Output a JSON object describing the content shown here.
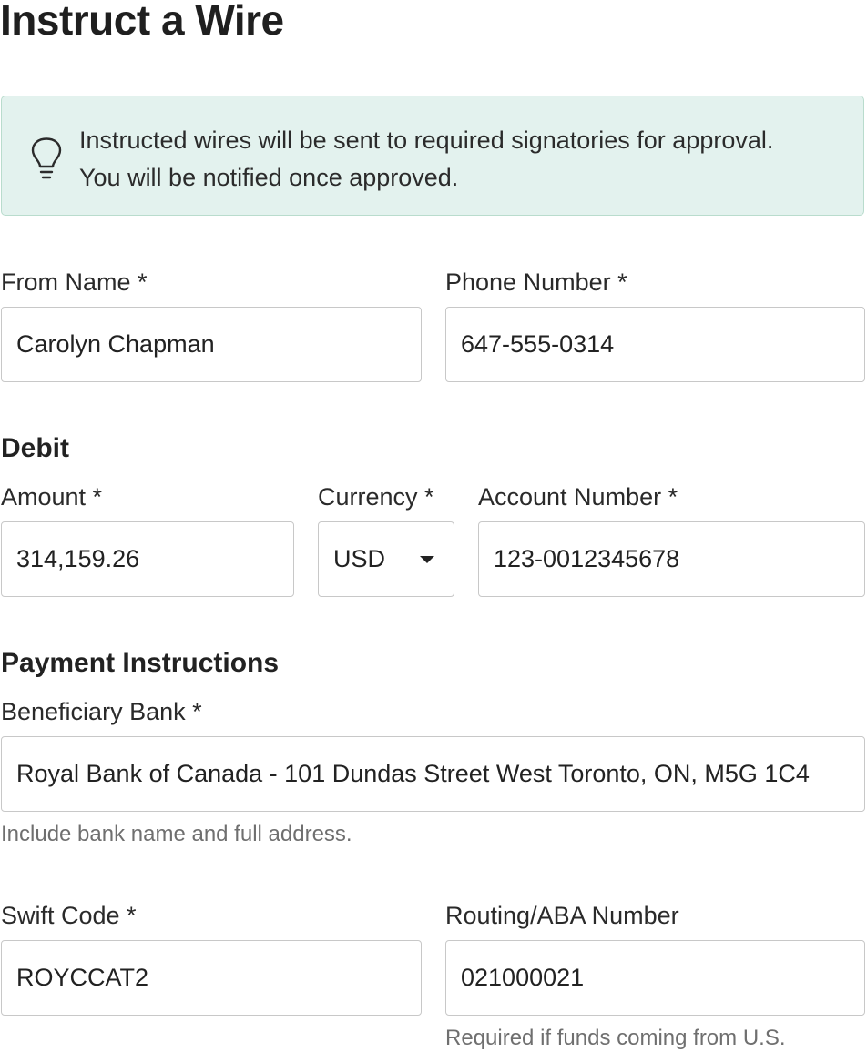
{
  "page": {
    "title": "Instruct a Wire"
  },
  "notice": {
    "icon": "lightbulb-icon",
    "line1": "Instructed wires will be sent to required signatories for approval.",
    "line2": "You will be notified once approved.",
    "background": "#e3f2ee",
    "border": "#b9dccd"
  },
  "from_name": {
    "label": "From Name *",
    "value": "Carolyn Chapman"
  },
  "phone_number": {
    "label": "Phone Number *",
    "value": "647-555-0314"
  },
  "debit": {
    "heading": "Debit",
    "amount": {
      "label": "Amount *",
      "value": "314,159.26"
    },
    "currency": {
      "label": "Currency *",
      "value": "USD",
      "icon": "caret-down-icon"
    },
    "account_number": {
      "label": "Account Number *",
      "value": "123-0012345678"
    }
  },
  "payment": {
    "heading": "Payment Instructions",
    "beneficiary_bank": {
      "label": "Beneficiary Bank *",
      "value": "Royal Bank of Canada - 101 Dundas Street West Toronto, ON, M5G 1C4",
      "help": "Include bank name and full address."
    },
    "swift_code": {
      "label": "Swift Code *",
      "value": "ROYCCAT2"
    },
    "routing_number": {
      "label": "Routing/ABA Number",
      "value": "021000021",
      "help": "Required if funds coming from U.S."
    }
  }
}
